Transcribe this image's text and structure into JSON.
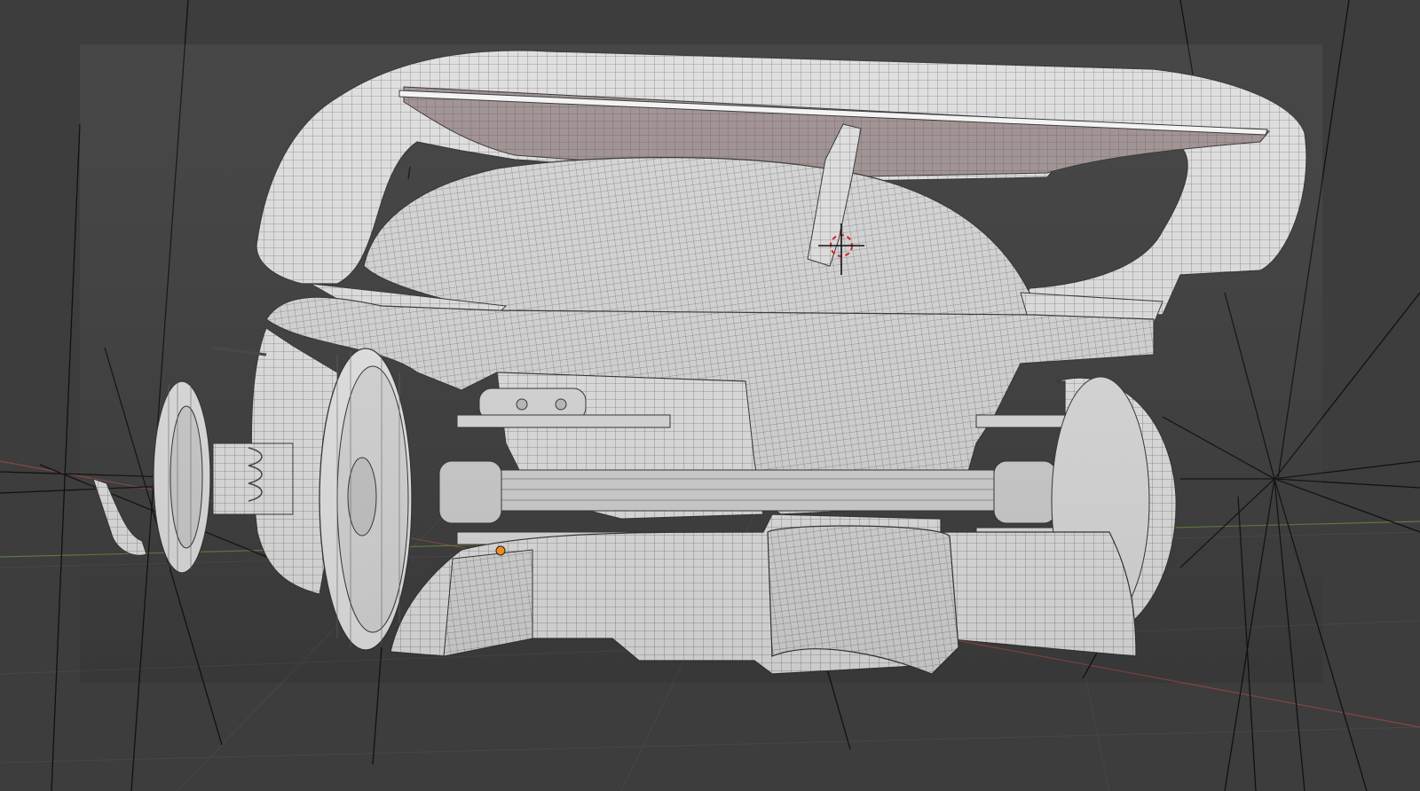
{
  "viewport": {
    "background": "#3d3d3d",
    "mesh_fill": "#dcdcdc",
    "mesh_shadow": "#a9a9a9",
    "wire_color": "#4a4a4a",
    "x_axis_color": "#8a4545",
    "y_axis_color": "#5d7a3c",
    "light_dot_color": "#f08c1e",
    "cursor_color": "#d22222"
  }
}
